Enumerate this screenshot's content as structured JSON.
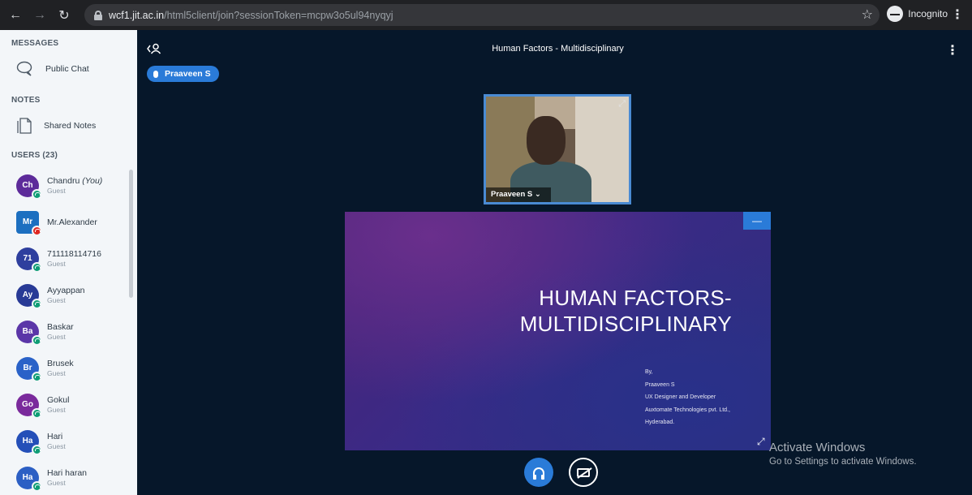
{
  "browser": {
    "url_host": "wcf1.jit.ac.in",
    "url_path": "/html5client/join?sessionToken=mcpw3o5ul94nyqyj",
    "incognito_label": "Incognito"
  },
  "sidebar": {
    "messages_title": "MESSAGES",
    "public_chat": "Public Chat",
    "notes_title": "NOTES",
    "shared_notes": "Shared Notes",
    "users_title": "USERS (23)",
    "users": [
      {
        "initials": "Ch",
        "name": "Chandru",
        "you": "(You)",
        "role": "Guest",
        "color": "#5d2b9a"
      },
      {
        "initials": "Mr",
        "name": "Mr.Alexander",
        "you": "",
        "role": "",
        "color": "#1c6fc0"
      },
      {
        "initials": "71",
        "name": "711118114716",
        "you": "",
        "role": "Guest",
        "color": "#2e3f9e"
      },
      {
        "initials": "Ay",
        "name": "Ayyappan",
        "you": "",
        "role": "Guest",
        "color": "#283a96"
      },
      {
        "initials": "Ba",
        "name": "Baskar",
        "you": "",
        "role": "Guest",
        "color": "#5b36a8"
      },
      {
        "initials": "Br",
        "name": "Brusek",
        "you": "",
        "role": "Guest",
        "color": "#2a62c8"
      },
      {
        "initials": "Go",
        "name": "Gokul",
        "you": "",
        "role": "Guest",
        "color": "#7a2a9c"
      },
      {
        "initials": "Ha",
        "name": "Hari",
        "you": "",
        "role": "Guest",
        "color": "#244fb8"
      },
      {
        "initials": "Ha",
        "name": "Hari haran",
        "you": "",
        "role": "Guest",
        "color": "#2c5fc4"
      }
    ]
  },
  "main": {
    "title": "Human Factors - Multidisciplinary",
    "talker": "Praaveen S",
    "webcam_name": "Praaveen S",
    "slide": {
      "title_line1": "HUMAN FACTORS-",
      "title_line2": "MULTIDISCIPLINARY",
      "credit_by": "By,",
      "credit_name": "Praaveen S",
      "credit_role": "UX Designer and Developer",
      "credit_company": "Auxtomate Technologies pvt. Ltd.,",
      "credit_city": "Hyderabad."
    }
  },
  "watermark": {
    "line1": "Activate Windows",
    "line2": "Go to Settings to activate Windows."
  },
  "colors": {
    "accent": "#2a7bd8",
    "background": "#06172a",
    "sidebar": "#f3f6f9"
  }
}
